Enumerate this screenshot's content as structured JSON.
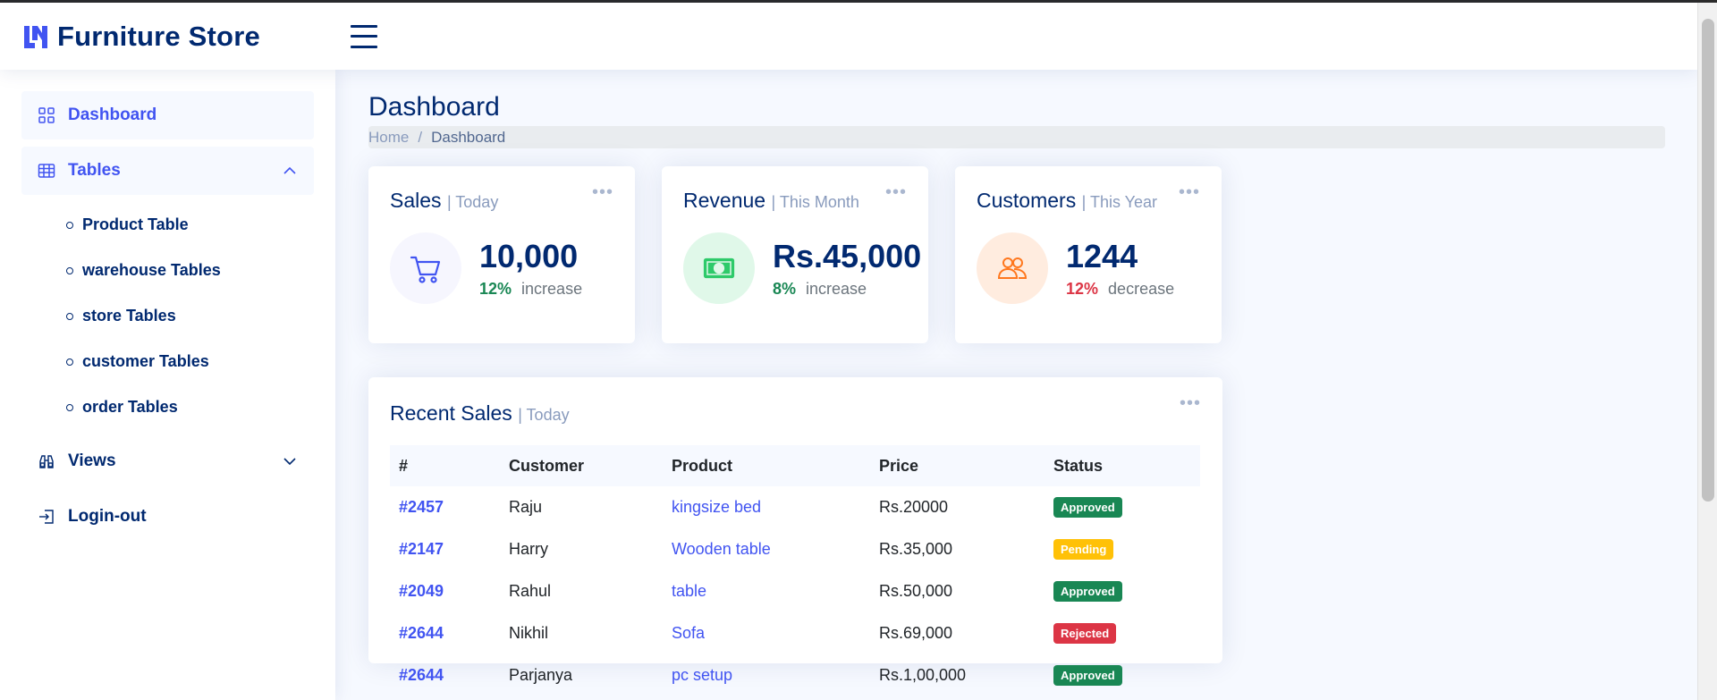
{
  "header": {
    "logo_text": "Furniture Store"
  },
  "sidebar": {
    "dashboard": "Dashboard",
    "tables": "Tables",
    "sub_items": [
      "Product Table",
      "warehouse Tables",
      "store Tables",
      "customer Tables",
      "order Tables"
    ],
    "views": "Views",
    "logout": "Login-out"
  },
  "page": {
    "title": "Dashboard",
    "breadcrumb_home": "Home",
    "breadcrumb_sep": "/",
    "breadcrumb_current": "Dashboard"
  },
  "cards": {
    "sales": {
      "title": "Sales",
      "period": "| Today",
      "value": "10,000",
      "pct": "12%",
      "label": "increase"
    },
    "revenue": {
      "title": "Revenue",
      "period": "| This Month",
      "value": "Rs.45,000",
      "pct": "8%",
      "label": "increase"
    },
    "customers": {
      "title": "Customers",
      "period": "| This Year",
      "value": "1244",
      "pct": "12%",
      "label": "decrease"
    }
  },
  "recent_sales": {
    "title": "Recent Sales",
    "period": "| Today",
    "columns": [
      "#",
      "Customer",
      "Product",
      "Price",
      "Status"
    ],
    "rows": [
      {
        "id": "#2457",
        "customer": "Raju",
        "product": "kingsize bed",
        "price": "Rs.20000",
        "status": "Approved"
      },
      {
        "id": "#2147",
        "customer": "Harry",
        "product": "Wooden table",
        "price": "Rs.35,000",
        "status": "Pending"
      },
      {
        "id": "#2049",
        "customer": "Rahul",
        "product": "table",
        "price": "Rs.50,000",
        "status": "Approved"
      },
      {
        "id": "#2644",
        "customer": "Nikhil",
        "product": "Sofa",
        "price": "Rs.69,000",
        "status": "Rejected"
      },
      {
        "id": "#2644",
        "customer": "Parjanya",
        "product": "pc setup",
        "price": "Rs.1,00,000",
        "status": "Approved"
      }
    ]
  },
  "colors": {
    "primary": "#4154f1",
    "navy": "#012970",
    "success": "#198754",
    "warning": "#ffc107",
    "danger": "#dc3545"
  },
  "icons": {
    "logo": "logo-icon",
    "menu": "hamburger-icon",
    "dashboard": "grid-icon",
    "tables": "table-icon",
    "views": "binoculars-icon",
    "logout": "box-arrow-in-right-icon",
    "sales": "cart-icon",
    "revenue": "cash-icon",
    "customers": "people-icon",
    "more": "three-dots-icon"
  }
}
